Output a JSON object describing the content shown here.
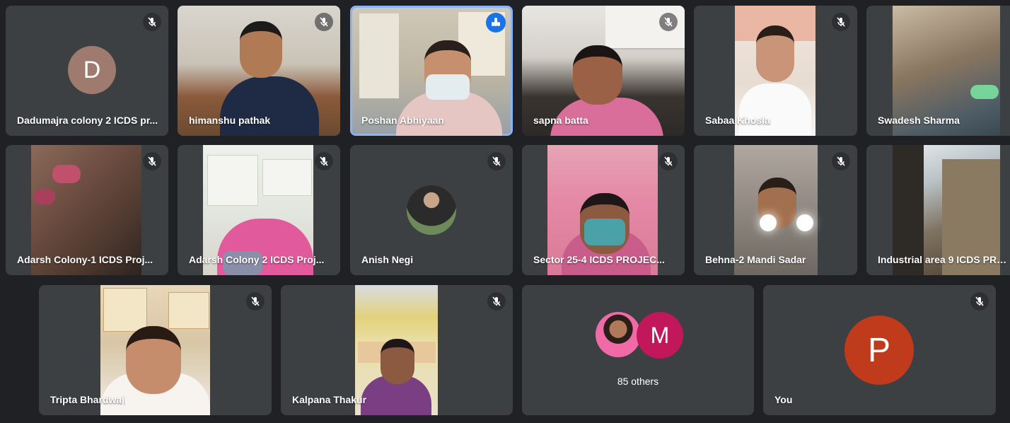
{
  "participants": [
    {
      "name": "Dadumajra colony 2 ICDS pr...",
      "initial": "D",
      "avatar_color": "#9e7a6f"
    },
    {
      "name": "himanshu pathak"
    },
    {
      "name": "Poshan Abhiyaan"
    },
    {
      "name": "sapna batta"
    },
    {
      "name": "Sabaa Khosla"
    },
    {
      "name": "Swadesh Sharma"
    },
    {
      "name": "Adarsh Colony-1 ICDS Proj..."
    },
    {
      "name": "Adarsh Colony 2 ICDS Proj..."
    },
    {
      "name": "Anish Negi"
    },
    {
      "name": "Sector 25-4 ICDS PROJEC..."
    },
    {
      "name": "Behna-2 Mandi Sadar"
    },
    {
      "name": "Industrial area 9 ICDS PRO..."
    },
    {
      "name": "Tripta Bhardwaj"
    },
    {
      "name": "Kalpana Thakur"
    },
    {
      "name": "You",
      "initial": "P",
      "avatar_color": "#c03a1c"
    }
  ],
  "others": {
    "label": "85 others",
    "avatar_initial": "M",
    "avatar_color": "#c2185b"
  },
  "colors": {
    "background": "#202124",
    "tile": "#3c4043",
    "active_border": "#8ab4f8",
    "speaking": "#1a73e8"
  },
  "icons": {
    "muted": "mic-off-icon",
    "speaking": "audio-level-icon"
  }
}
